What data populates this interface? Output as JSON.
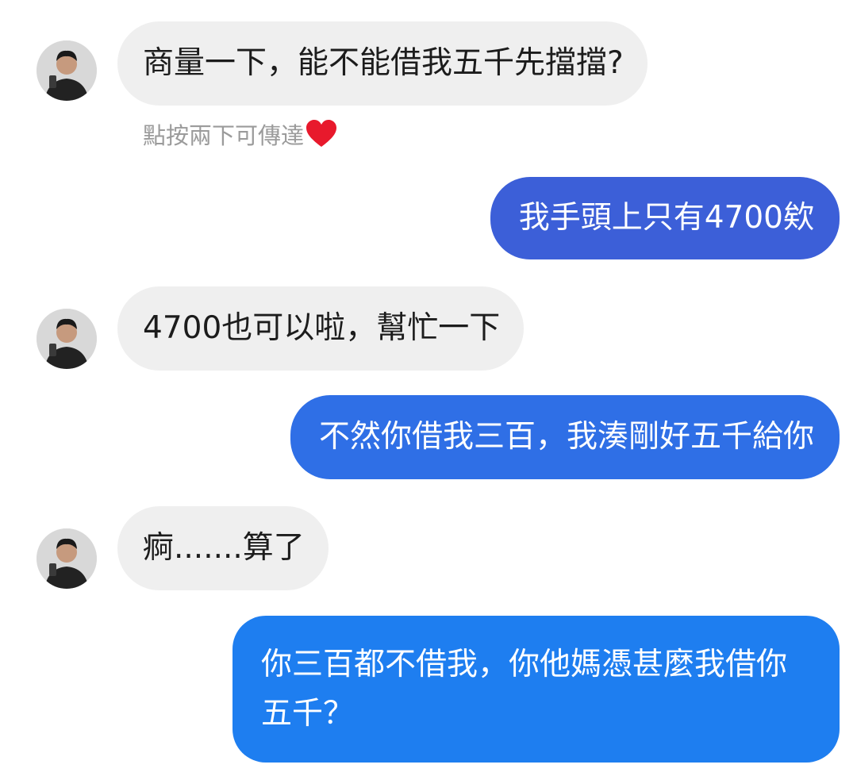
{
  "messages": [
    {
      "sender": "contact",
      "text": "商量一下，能不能借我五千先擋擋?"
    },
    {
      "sender": "me",
      "text": "我手頭上只有4700欸"
    },
    {
      "sender": "contact",
      "text": "4700也可以啦，幫忙一下"
    },
    {
      "sender": "me",
      "text": "不然你借我三百，我湊剛好五千給你"
    },
    {
      "sender": "contact",
      "text": "痾.......算了"
    },
    {
      "sender": "me",
      "text": "你三百都不借我，你他媽憑甚麼我借你五千？"
    }
  ],
  "reaction_hint": {
    "text": "點按兩下可傳達",
    "icon": "heart-icon",
    "color": "#e8192c"
  },
  "colors": {
    "incoming_bubble": "#efefef",
    "outgoing_gradient": [
      "#3c5fd8",
      "#2f6fe6",
      "#1e7ef0"
    ]
  }
}
